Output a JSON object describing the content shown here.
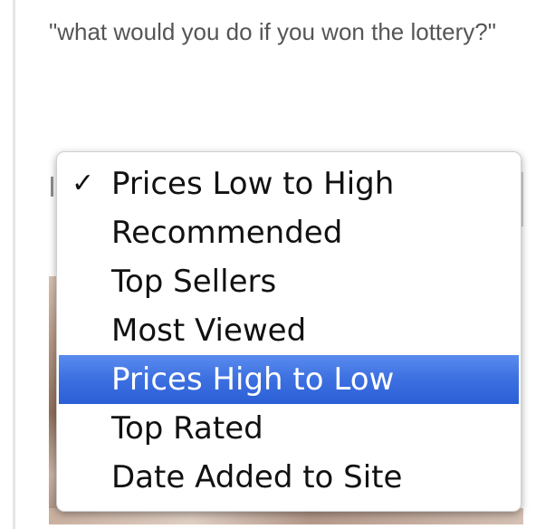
{
  "post": {
    "text": "\"what would you do if you won the lottery?\""
  },
  "menu": {
    "checkmark_glyph": "✓",
    "selected_index": 0,
    "highlighted_index": 4,
    "highlight_color": "#3c6fe0",
    "items": [
      {
        "label": "Prices Low to High",
        "checked": true
      },
      {
        "label": "Recommended",
        "checked": false
      },
      {
        "label": "Top Sellers",
        "checked": false
      },
      {
        "label": "Most Viewed",
        "checked": false
      },
      {
        "label": "Prices High to Low",
        "checked": false,
        "highlighted": true
      },
      {
        "label": "Top Rated",
        "checked": false
      },
      {
        "label": "Date Added to Site",
        "checked": false
      }
    ]
  }
}
